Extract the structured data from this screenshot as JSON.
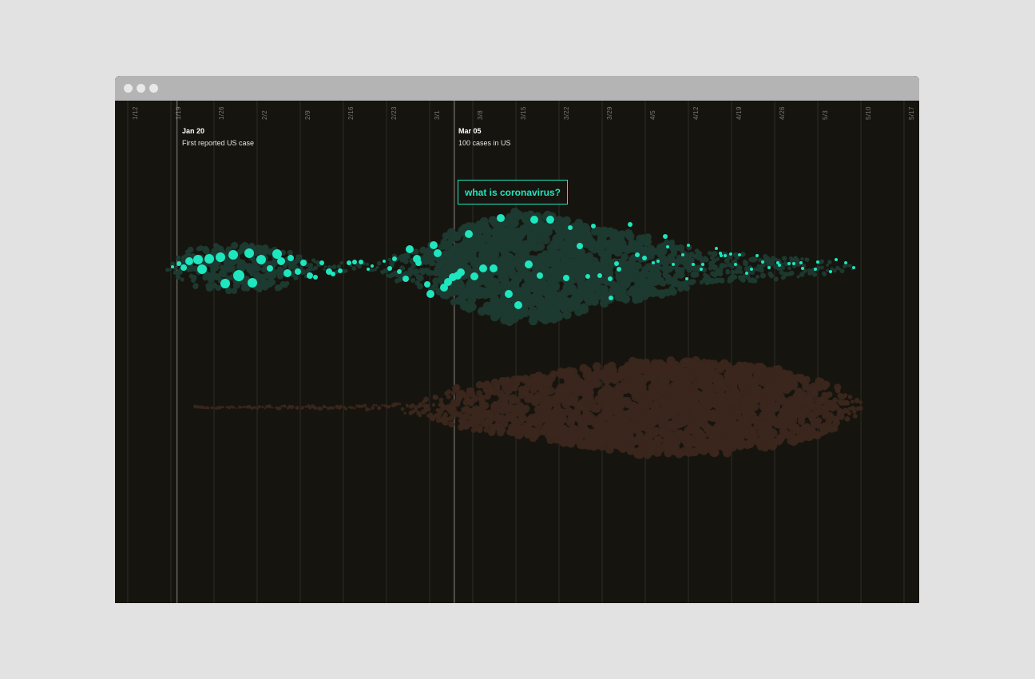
{
  "window": {
    "controls": [
      "window-dot",
      "window-dot",
      "window-dot"
    ]
  },
  "events": [
    {
      "date": "Jan 20",
      "label": "First reported US case",
      "x": "1/20"
    },
    {
      "date": "Mar 05",
      "label": "100 cases in US",
      "x": "3/5"
    }
  ],
  "query": {
    "label": "what is coronavirus?"
  },
  "colors": {
    "background": "#16140e",
    "highlight": "#1ee6bf",
    "green_bubble": "#1e3a31",
    "brown_bubble": "#3a261c",
    "gridline": "#2c2b25"
  },
  "chart_data": {
    "type": "scatter",
    "xaxis_ticks": [
      "1/12",
      "1/19",
      "1/26",
      "2/2",
      "2/9",
      "2/16",
      "2/23",
      "3/1",
      "3/8",
      "3/15",
      "3/22",
      "3/29",
      "4/5",
      "4/12",
      "4/19",
      "4/26",
      "5/3",
      "5/10",
      "5/17"
    ],
    "grid": true,
    "series": [
      {
        "values": []
      },
      {
        "values": []
      }
    ]
  }
}
